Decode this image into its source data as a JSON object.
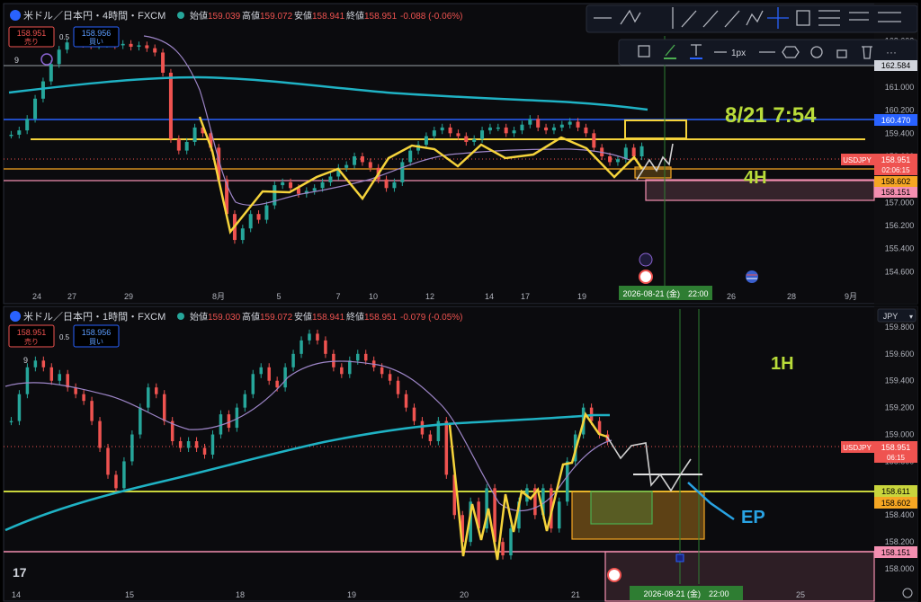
{
  "panels": [
    {
      "symbol": "米ドル／日本円・4時間・FXCM",
      "ohlc": {
        "open_label": "始値",
        "open": "159.039",
        "high_label": "高値",
        "high": "159.072",
        "low_label": "安値",
        "low": "158.941",
        "close_label": "終値",
        "close": "158.951",
        "change": "-0.088 (-0.06%)"
      },
      "sell_price": "158.951",
      "sell_label": "売り",
      "buy_price": "158.956",
      "buy_label": "買い",
      "spread": "0.5",
      "indicator_count": "9",
      "annotation_time": "8/21 7:54",
      "annotation_tf": "4H",
      "price_tags": {
        "symbol": "USDJPY",
        "last": "158.951",
        "countdown": "02:06:15",
        "level_orange": "158.602",
        "level_pink": "158.151",
        "level_blue": "160.470",
        "level_top": "162.584"
      },
      "date_label": "2026-08-21 (金)　22:00"
    },
    {
      "symbol": "米ドル／日本円・1時間・FXCM",
      "ohlc": {
        "open_label": "始値",
        "open": "159.030",
        "high_label": "高値",
        "high": "159.072",
        "low_label": "安値",
        "low": "158.941",
        "close_label": "終値",
        "close": "158.951",
        "change": "-0.079 (-0.05%)"
      },
      "sell_price": "158.951",
      "sell_label": "売り",
      "buy_price": "158.956",
      "buy_label": "買い",
      "spread": "0.5",
      "indicator_count": "9",
      "annotation_tf": "1H",
      "annotation_ep": "EP",
      "currency": "JPY",
      "price_tags": {
        "symbol": "USDJPY",
        "last": "158.951",
        "countdown": "06:15",
        "level_olive": "158.611",
        "level_orange": "158.602",
        "level_pink": "158.151"
      },
      "date_label": "2026-08-21 (金)　22:00"
    }
  ],
  "toolbar": {
    "stroke_width": "1px"
  },
  "colors": {
    "up": "#26a69a",
    "down": "#ef5350",
    "yellow": "#f5d33b",
    "ma_long": "#1fb2c4",
    "ma_short": "#9d85c7",
    "blue": "#2962ff",
    "pink": "#f48fb1",
    "orange": "#f5a623",
    "olive": "#c9d53c",
    "green_text": "#b9dc3a",
    "ep": "#29a3e3"
  },
  "chart_data": [
    {
      "type": "candlestick",
      "title": "米ドル／日本円・4時間・FXCM",
      "x_ticks": [
        "24",
        "27",
        "29",
        "8月",
        "5",
        "7",
        "10",
        "12",
        "14",
        "17",
        "19",
        "21",
        "26",
        "28",
        "9月"
      ],
      "y_ticks": [
        154.6,
        155.4,
        156.2,
        157.0,
        157.8,
        158.6,
        159.4,
        160.2,
        161.0,
        161.8,
        162.6
      ],
      "ylim": [
        154.3,
        162.9
      ],
      "grid": false,
      "support_resistance": [
        160.47,
        159.95,
        158.95,
        158.6,
        158.15
      ],
      "current_price": 158.951,
      "candles_close_path": [
        159.35,
        159.5,
        159.9,
        160.6,
        161.2,
        161.8,
        162.3,
        162.55,
        162.6,
        162.5,
        162.45,
        162.5,
        162.55,
        162.45,
        162.5,
        162.4,
        162.45,
        162.35,
        162.2,
        161.5,
        159.2,
        158.8,
        159.1,
        159.6,
        159.4,
        158.9,
        157.8,
        156.6,
        155.7,
        156.1,
        156.6,
        156.4,
        156.9,
        157.6,
        157.7,
        157.5,
        157.3,
        157.4,
        157.5,
        157.7,
        157.9,
        158.2,
        158.3,
        158.6,
        158.4,
        158.2,
        157.8,
        157.5,
        157.7,
        158.4,
        158.8,
        159.0,
        159.3,
        159.5,
        159.6,
        159.4,
        159.3,
        159.1,
        159.2,
        159.5,
        159.6,
        159.6,
        159.4,
        159.5,
        159.7,
        159.9,
        159.6,
        159.5,
        159.6,
        159.7,
        159.8,
        159.6,
        159.4,
        158.9,
        158.6,
        158.4,
        158.5,
        158.9,
        158.6,
        158.95
      ]
    },
    {
      "type": "candlestick",
      "title": "米ドル／日本円・1時間・FXCM",
      "x_ticks": [
        "14",
        "15",
        "18",
        "19",
        "20",
        "21",
        "25"
      ],
      "y_ticks": [
        158.0,
        158.2,
        158.4,
        158.6,
        158.8,
        159.0,
        159.2,
        159.4,
        159.6,
        159.8
      ],
      "ylim": [
        157.9,
        159.92
      ],
      "grid": false,
      "support_resistance": [
        158.611,
        158.602,
        158.151
      ],
      "current_price": 158.951,
      "candles_close_path": [
        159.1,
        159.3,
        159.5,
        159.55,
        159.5,
        159.4,
        159.45,
        159.35,
        159.3,
        159.25,
        159.1,
        158.9,
        158.7,
        158.6,
        158.8,
        159.0,
        159.2,
        159.35,
        159.3,
        159.1,
        158.95,
        158.9,
        158.95,
        158.9,
        158.85,
        159.0,
        159.15,
        159.05,
        159.2,
        159.3,
        159.45,
        159.5,
        159.4,
        159.35,
        159.5,
        159.6,
        159.7,
        159.75,
        159.7,
        159.6,
        159.5,
        159.45,
        159.55,
        159.6,
        159.55,
        159.5,
        159.45,
        159.4,
        159.3,
        159.2,
        159.1,
        159.0,
        158.95,
        159.1,
        158.7,
        158.4,
        158.2,
        158.5,
        158.3,
        158.6,
        158.2,
        158.1,
        158.3,
        158.5,
        158.6,
        158.4,
        158.6,
        158.3,
        158.5,
        158.8,
        159.0,
        159.2,
        159.1,
        159.0,
        158.95
      ]
    }
  ]
}
